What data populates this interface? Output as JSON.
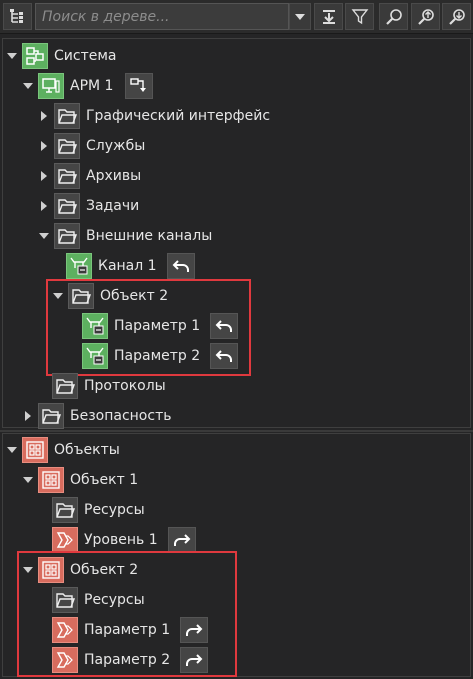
{
  "toolbar": {
    "search_placeholder": "Поиск в дереве...",
    "icons": [
      "tree-root-icon",
      "dropdown-icon",
      "collapse-all-icon",
      "filter-icon",
      "search-icon",
      "search-up-icon",
      "search-down-icon"
    ]
  },
  "colors": {
    "accent_green": "#5db060",
    "accent_red": "#d86c5e",
    "highlight": "#e0393e"
  },
  "system_tree": {
    "root": "Система",
    "arm": "АРМ 1",
    "children": {
      "gui": "Графический интерфейс",
      "services": "Службы",
      "archives": "Архивы",
      "tasks": "Задачи",
      "ext_channels": "Внешние каналы",
      "channel1": "Канал 1",
      "object2": "Объект 2",
      "param1": "Параметр 1",
      "param2": "Параметр 2",
      "protocols": "Протоколы",
      "security": "Безопасность"
    }
  },
  "objects_tree": {
    "root": "Объекты",
    "object1": "Объект 1",
    "resources1": "Ресурсы",
    "level1": "Уровень 1",
    "object2": "Объект 2",
    "resources2": "Ресурсы",
    "param1": "Параметр 1",
    "param2": "Параметр 2"
  }
}
